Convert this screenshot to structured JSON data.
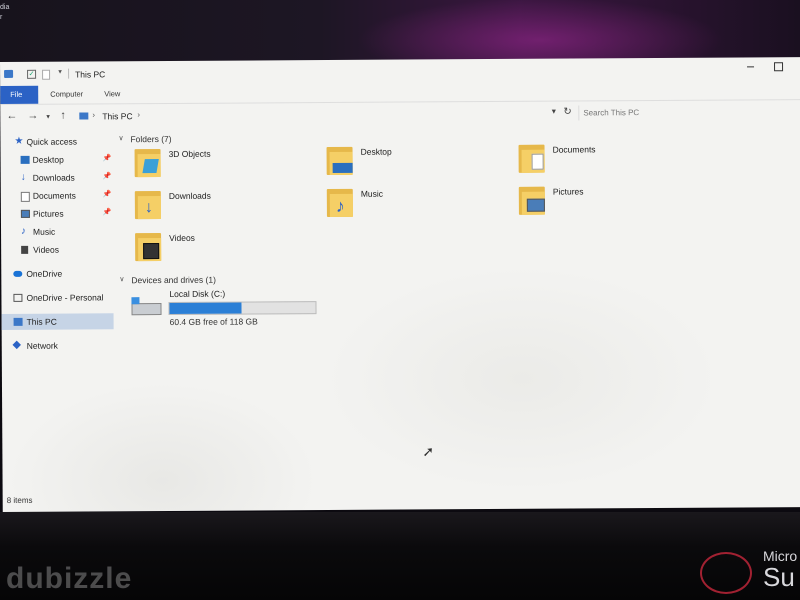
{
  "desktop": {
    "corner_text": [
      "dia",
      "r"
    ]
  },
  "watermark": "dubizzle",
  "brand": {
    "line1": "Micro",
    "line2": "Su"
  },
  "titlebar": {
    "title": "This PC"
  },
  "ribbon": {
    "tabs": [
      "File",
      "Computer",
      "View"
    ]
  },
  "address": {
    "location": "This PC",
    "search_placeholder": "Search This PC"
  },
  "sidebar": {
    "quick_access": "Quick access",
    "items": [
      {
        "label": "Desktop",
        "pinned": true
      },
      {
        "label": "Downloads",
        "pinned": true
      },
      {
        "label": "Documents",
        "pinned": true
      },
      {
        "label": "Pictures",
        "pinned": true
      },
      {
        "label": "Music",
        "pinned": false
      },
      {
        "label": "Videos",
        "pinned": false
      }
    ],
    "onedrive": "OneDrive",
    "onedrive_personal": "OneDrive - Personal",
    "this_pc": "This PC",
    "network": "Network"
  },
  "content": {
    "folders_header": "Folders (7)",
    "folders": [
      "3D Objects",
      "Desktop",
      "Documents",
      "Downloads",
      "Music",
      "Pictures",
      "Videos"
    ],
    "devices_header": "Devices and drives (1)",
    "drive": {
      "name": "Local Disk (C:)",
      "free_text": "60.4 GB free of 118 GB",
      "used_fraction": 0.49
    }
  },
  "status": {
    "item_count": "8 items"
  }
}
